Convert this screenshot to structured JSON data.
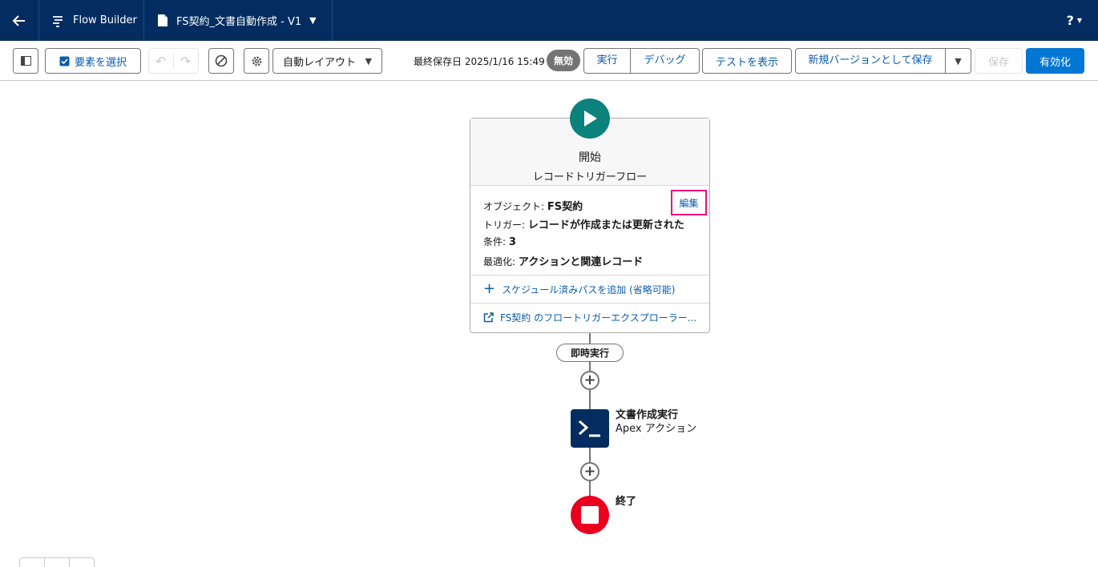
{
  "header": {
    "app_name": "Flow Builder",
    "flow_title": "FS契約_文書自動作成 - V1",
    "help_label": "?"
  },
  "toolbar": {
    "select_elements_label": "要素を選択",
    "layout_label": "自動レイアウト",
    "last_saved": "最終保存日 2025/1/16 15:49",
    "status_badge": "無効",
    "run_label": "実行",
    "debug_label": "デバッグ",
    "show_tests_label": "テストを表示",
    "save_new_version_label": "新規バージョンとして保存",
    "save_label": "保存",
    "activate_label": "有効化"
  },
  "start": {
    "title": "開始",
    "subtitle": "レコードトリガーフロー",
    "object_label": "オブジェクト: ",
    "object_value": "FS契約",
    "edit_label": "編集",
    "trigger_label": "トリガー: ",
    "trigger_value": "レコードが作成または更新された",
    "condition_label": "条件: ",
    "condition_value": "3",
    "optimize_label": "最適化: ",
    "optimize_value": "アクションと関連レコード",
    "add_scheduled_path": "スケジュール済みパスを追加 (省略可能)",
    "explorer_link": "FS契約 のフロートリガーエクスプローラー..."
  },
  "path_label": "即時実行",
  "action": {
    "title": "文書作成実行",
    "subtitle": "Apex アクション"
  },
  "end_label": "終了",
  "colors": {
    "header_bg": "#032d60",
    "brand_blue": "#0176d3",
    "start_green": "#0b827c",
    "end_red": "#ea001e",
    "highlight_pink": "#e8107a"
  }
}
